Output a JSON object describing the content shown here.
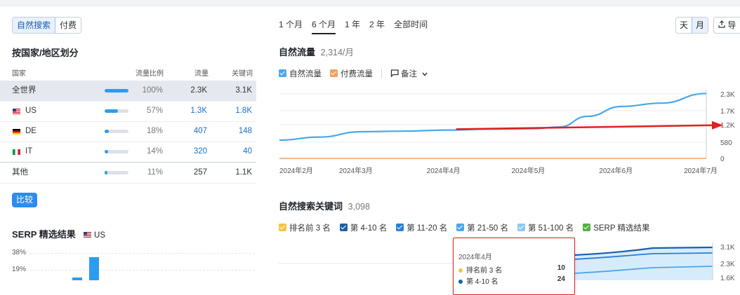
{
  "tabs": {
    "organic_search": "自然搜索",
    "paid": "付费"
  },
  "geo": {
    "title": "按国家/地区划分",
    "columns": {
      "country": "国家",
      "share": "流量比例",
      "traffic": "流量",
      "keywords": "关键词"
    },
    "rows": [
      {
        "name": "全世界",
        "share": "100%",
        "share_value": 1.0,
        "traffic": "2.3K",
        "keywords": "3.1K"
      },
      {
        "name": "US",
        "share": "57%",
        "share_value": 0.57,
        "traffic": "1.3K",
        "keywords": "1.8K"
      },
      {
        "name": "DE",
        "share": "18%",
        "share_value": 0.18,
        "traffic": "407",
        "keywords": "148"
      },
      {
        "name": "IT",
        "share": "14%",
        "share_value": 0.14,
        "traffic": "320",
        "keywords": "40"
      },
      {
        "name": "其他",
        "share": "11%",
        "share_value": 0.11,
        "traffic": "257",
        "keywords": "1.1K"
      }
    ],
    "compare_button": "比较"
  },
  "serp": {
    "title": "SERP 精选结果",
    "region": "US",
    "y_ticks": [
      "38%",
      "19%"
    ],
    "chart_data": {
      "type": "bar",
      "y_ticks": [
        "38%",
        "19%"
      ],
      "values_visible_partial": true
    }
  },
  "periods": {
    "items": [
      "1 个月",
      "6 个月",
      "1 年",
      "2 年",
      "全部时间"
    ],
    "active": "6 个月"
  },
  "granularity": {
    "day": "天",
    "month": "月",
    "active": "月"
  },
  "export_label": "导",
  "traffic": {
    "title": "自然流量",
    "value": "2,314/月",
    "legend": {
      "organic": "自然流量",
      "paid": "付费流量",
      "notes": "备注"
    },
    "colors": {
      "organic": "#4aa8e8",
      "paid": "#f0a060",
      "arrow": "#e02020"
    },
    "chart_data": {
      "type": "line",
      "x_ticks": [
        "2024年2月",
        "2024年3月",
        "2024年4月",
        "2024年5月",
        "2024年6月",
        "2024年7月"
      ],
      "y_ticks": [
        "2.3K",
        "1.7K",
        "1.2K",
        "580",
        "0"
      ],
      "ylim": [
        0,
        2300
      ],
      "series": [
        {
          "name": "自然流量",
          "x": [
            "2024-02-01",
            "2024-02-15",
            "2024-03-01",
            "2024-03-15",
            "2024-04-01",
            "2024-04-15",
            "2024-05-01",
            "2024-05-10",
            "2024-05-20",
            "2024-06-01",
            "2024-06-15",
            "2024-07-01"
          ],
          "values": [
            650,
            760,
            950,
            970,
            1010,
            1040,
            1060,
            1120,
            1500,
            1850,
            1970,
            2314
          ]
        },
        {
          "name": "付费流量",
          "x": [
            "2024-02-01",
            "2024-07-01"
          ],
          "values": [
            0,
            0
          ]
        }
      ]
    }
  },
  "keywords": {
    "title": "自然搜索关键词",
    "value": "3,098",
    "legend": [
      "排名前 3 名",
      "第 4-10 名",
      "第 11-20 名",
      "第 21-50 名",
      "第 51-100 名",
      "SERP 精选结果"
    ],
    "legend_colors": [
      "#f5c542",
      "#1b5fa8",
      "#2a7fd4",
      "#4aa8e8",
      "#8cc8f0",
      "#52b043"
    ],
    "y_ticks": [
      "3.1K",
      "2.3K",
      "1.6K"
    ],
    "tooltip": {
      "date": "2024年4月",
      "rows": [
        {
          "label": "排名前 3 名",
          "value": "10",
          "color": "#f5c542"
        },
        {
          "label": "第 4-10 名",
          "value": "24",
          "color": "#1b5fa8"
        }
      ]
    }
  }
}
